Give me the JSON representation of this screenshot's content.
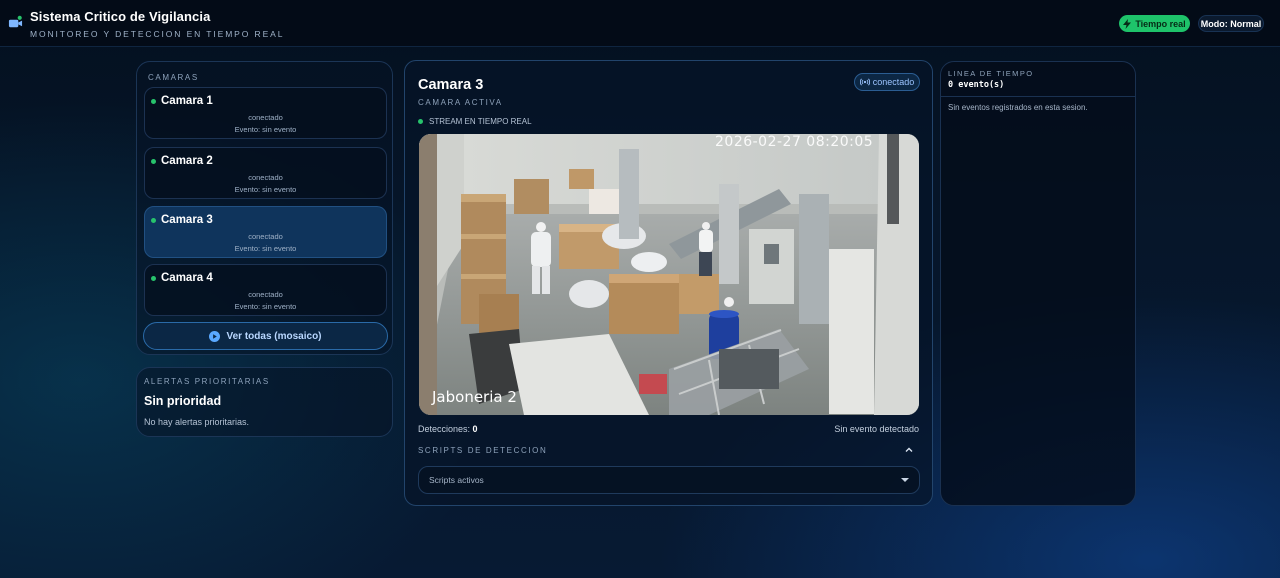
{
  "header": {
    "title": "Sistema Critico de Vigilancia",
    "subtitle": "MONITOREO Y DETECCION EN TIEMPO REAL",
    "live_badge": "Tiempo real",
    "mode_badge": "Modo: Normal",
    "icon": "video-camera-icon"
  },
  "sidebar": {
    "caption": "CAMARAS",
    "cameras": [
      {
        "name": "Camara 1",
        "status": "conectado",
        "event": "Evento: sin evento",
        "active": false
      },
      {
        "name": "Camara 2",
        "status": "conectado",
        "event": "Evento: sin evento",
        "active": false
      },
      {
        "name": "Camara 3",
        "status": "conectado",
        "event": "Evento: sin evento",
        "active": true
      },
      {
        "name": "Camara 4",
        "status": "conectado",
        "event": "Evento: sin evento",
        "active": false
      }
    ],
    "mosaic_button": "Ver todas (mosaico)"
  },
  "alerts": {
    "caption": "ALERTAS PRIORITARIAS",
    "title": "Sin prioridad",
    "text": "No hay alertas prioritarias."
  },
  "main": {
    "camera_title": "Camara 3",
    "camera_subtitle": "CAMARA ACTIVA",
    "connection_badge": "conectado",
    "stream_label": "STREAM EN TIEMPO REAL",
    "video_timestamp": "2026-02-27 08:20:05",
    "video_overlay_label": "Jaboneria 2",
    "detections_label": "Detecciones:",
    "detections_count": "0",
    "detection_status": "Sin evento detectado",
    "scripts_caption": "SCRIPTS DE DETECCION",
    "scripts_select_value": "Scripts activos"
  },
  "timeline": {
    "caption": "LINEA DE TIEMPO",
    "count": "0 evento(s)",
    "empty_text": "Sin eventos registrados en esta sesion."
  },
  "colors": {
    "accent_green": "#1ec36a",
    "accent_blue": "#2a6aa8",
    "active_card": "#0f345c"
  }
}
